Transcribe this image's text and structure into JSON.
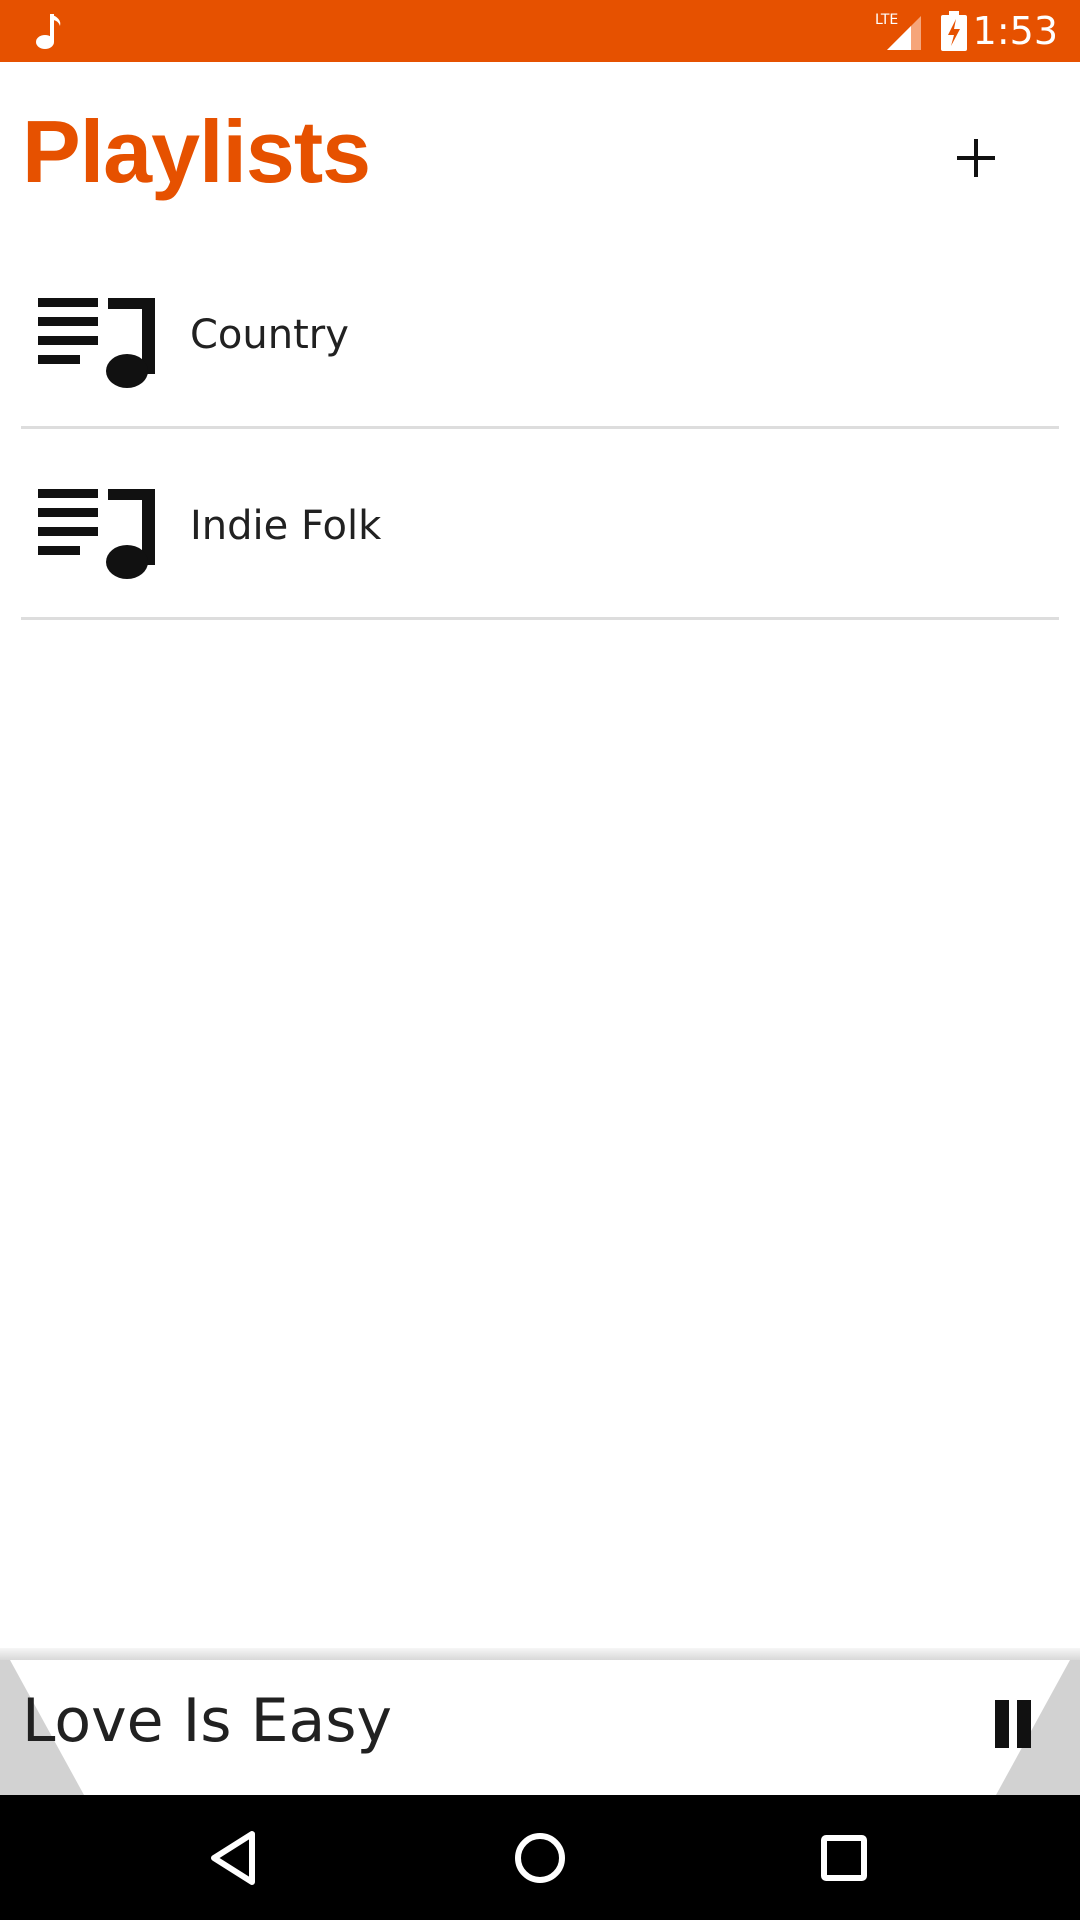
{
  "status_bar": {
    "time": "1:53",
    "network": "LTE",
    "icons": [
      "music-note-icon",
      "lte-signal-icon",
      "battery-charging-icon"
    ],
    "color": "#e65100"
  },
  "header": {
    "title": "Playlists",
    "add_icon": "plus-icon",
    "title_color": "#e65100"
  },
  "playlists": [
    {
      "label": "Country",
      "icon": "playlist-music-icon"
    },
    {
      "label": "Indie Folk",
      "icon": "playlist-music-icon"
    }
  ],
  "now_playing": {
    "title": "Love Is Easy",
    "control_icon": "pause-icon"
  },
  "nav_bar": {
    "buttons": [
      "back-icon",
      "home-icon",
      "recents-icon"
    ]
  }
}
